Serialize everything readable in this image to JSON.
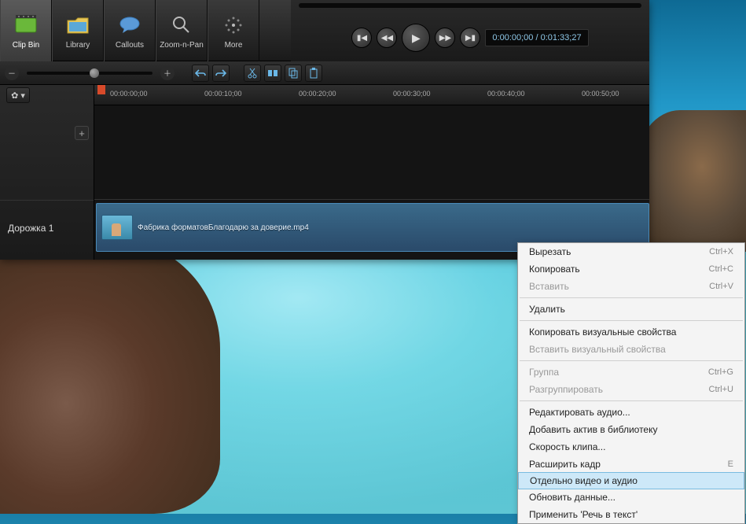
{
  "toolbar": {
    "items": [
      {
        "label": "Clip Bin",
        "name": "clip-bin"
      },
      {
        "label": "Library",
        "name": "library"
      },
      {
        "label": "Callouts",
        "name": "callouts"
      },
      {
        "label": "Zoom-n-Pan",
        "name": "zoom-n-pan"
      },
      {
        "label": "More",
        "name": "more"
      }
    ]
  },
  "playback": {
    "timecode": "0:00:00;00 / 0:01:33;27"
  },
  "timeline": {
    "ticks": [
      "00:00:00;00",
      "00:00:10;00",
      "00:00:20;00",
      "00:00:30;00",
      "00:00:40;00",
      "00:00:50;00"
    ],
    "track_label": "Дорожка 1",
    "clip_name": "Фабрика форматовБлагодарю за доверие.mp4"
  },
  "context_menu": {
    "items": [
      {
        "label": "Вырезать",
        "shortcut": "Ctrl+X",
        "enabled": true
      },
      {
        "label": "Копировать",
        "shortcut": "Ctrl+C",
        "enabled": true
      },
      {
        "label": "Вставить",
        "shortcut": "Ctrl+V",
        "enabled": false
      },
      {
        "sep": true
      },
      {
        "label": "Удалить",
        "enabled": true
      },
      {
        "sep": true
      },
      {
        "label": "Копировать визуальные свойства",
        "enabled": true
      },
      {
        "label": "Вставить визуальный свойства",
        "enabled": false
      },
      {
        "sep": true
      },
      {
        "label": "Группа",
        "shortcut": "Ctrl+G",
        "enabled": false
      },
      {
        "label": "Разгруппировать",
        "shortcut": "Ctrl+U",
        "enabled": false
      },
      {
        "sep": true
      },
      {
        "label": "Редактировать аудио...",
        "enabled": true
      },
      {
        "label": "Добавить актив в библиотеку",
        "enabled": true
      },
      {
        "label": "Скорость клипа...",
        "enabled": true
      },
      {
        "label": "Расширить кадр",
        "shortcut": "E",
        "enabled": true
      },
      {
        "label": "Отдельно видео и аудио",
        "enabled": true,
        "hover": true
      },
      {
        "label": "Обновить данные...",
        "enabled": true
      },
      {
        "label": "Применить 'Речь в текст'",
        "enabled": true
      }
    ]
  }
}
